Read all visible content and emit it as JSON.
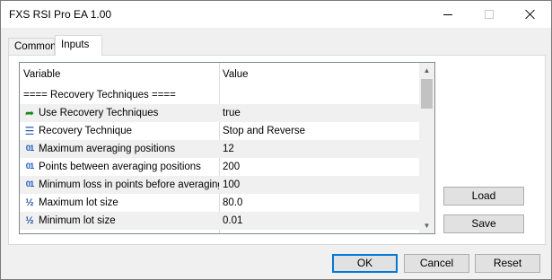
{
  "window": {
    "title": "FXS RSI Pro EA 1.00"
  },
  "tabs": [
    {
      "label": "Common",
      "active": false
    },
    {
      "label": "Inputs",
      "active": true
    }
  ],
  "grid": {
    "headers": {
      "variable": "Variable",
      "value": "Value"
    },
    "section_title": "==== Recovery Techniques ====",
    "rows": [
      {
        "icon": "bool-arrow-icon",
        "variable": "Use Recovery Techniques",
        "value": "true"
      },
      {
        "icon": "enum-list-icon",
        "variable": "Recovery Technique",
        "value": "Stop and Reverse"
      },
      {
        "icon": "integer-icon",
        "variable": "Maximum averaging positions",
        "value": "12"
      },
      {
        "icon": "integer-icon",
        "variable": "Points between averaging positions",
        "value": "200"
      },
      {
        "icon": "integer-icon",
        "variable": "Minimum loss in points before averaging",
        "value": "100"
      },
      {
        "icon": "double-fraction-icon",
        "variable": "Maximum lot size",
        "value": "80.0"
      },
      {
        "icon": "double-fraction-icon",
        "variable": "Minimum lot size",
        "value": "0.01"
      }
    ]
  },
  "side_buttons": {
    "load": "Load",
    "save": "Save"
  },
  "bottom_buttons": {
    "ok": "OK",
    "cancel": "Cancel",
    "reset": "Reset"
  },
  "icon_glyphs": {
    "int": "01",
    "frac": "½"
  },
  "colors": {
    "accent": "#0078d7",
    "alt_row": "#f0f0f0"
  }
}
